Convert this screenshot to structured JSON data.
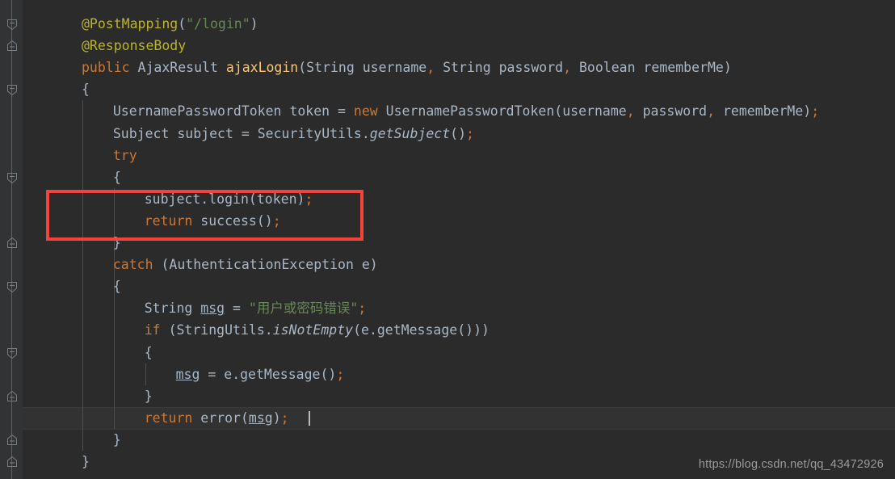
{
  "editor": {
    "background_color": "#2B2B2B",
    "gutter_color": "#313335",
    "current_line_color": "#323232",
    "caret_color": "#BBBBBB",
    "default_text_color": "#A9B7C6",
    "keyword_color": "#CC7832",
    "annotation_color": "#BBB529",
    "string_color": "#6A8759",
    "method_color": "#FFC66D",
    "highlight_box_color": "#F4433A"
  },
  "code": {
    "language": "Java",
    "lines": [
      {
        "n": 1,
        "indent": 0,
        "text": "@PostMapping(\"/login\")"
      },
      {
        "n": 2,
        "indent": 0,
        "text": "@ResponseBody"
      },
      {
        "n": 3,
        "indent": 0,
        "text": "public AjaxResult ajaxLogin(String username, String password, Boolean rememberMe)"
      },
      {
        "n": 4,
        "indent": 0,
        "text": "{"
      },
      {
        "n": 5,
        "indent": 1,
        "text": "UsernamePasswordToken token = new UsernamePasswordToken(username, password, rememberMe);"
      },
      {
        "n": 6,
        "indent": 1,
        "text": "Subject subject = SecurityUtils.getSubject();"
      },
      {
        "n": 7,
        "indent": 1,
        "text": "try"
      },
      {
        "n": 8,
        "indent": 1,
        "text": "{"
      },
      {
        "n": 9,
        "indent": 2,
        "text": "subject.login(token);"
      },
      {
        "n": 10,
        "indent": 2,
        "text": "return success();"
      },
      {
        "n": 11,
        "indent": 1,
        "text": "}"
      },
      {
        "n": 12,
        "indent": 1,
        "text": "catch (AuthenticationException e)"
      },
      {
        "n": 13,
        "indent": 1,
        "text": "{"
      },
      {
        "n": 14,
        "indent": 2,
        "text": "String msg = \"用户或密码错误\";"
      },
      {
        "n": 15,
        "indent": 2,
        "text": "if (StringUtils.isNotEmpty(e.getMessage()))"
      },
      {
        "n": 16,
        "indent": 2,
        "text": "{"
      },
      {
        "n": 17,
        "indent": 3,
        "text": "msg = e.getMessage();"
      },
      {
        "n": 18,
        "indent": 2,
        "text": "}"
      },
      {
        "n": 19,
        "indent": 2,
        "text": "return error(msg);"
      },
      {
        "n": 20,
        "indent": 1,
        "text": "}"
      },
      {
        "n": 21,
        "indent": 0,
        "text": "}"
      }
    ],
    "string_literals": [
      "/login",
      "用户或密码错误"
    ],
    "identifiers": [
      "PostMapping",
      "ResponseBody",
      "AjaxResult",
      "ajaxLogin",
      "String",
      "username",
      "password",
      "Boolean",
      "rememberMe",
      "UsernamePasswordToken",
      "token",
      "Subject",
      "subject",
      "SecurityUtils",
      "getSubject",
      "login",
      "success",
      "AuthenticationException",
      "e",
      "msg",
      "StringUtils",
      "isNotEmpty",
      "getMessage",
      "error"
    ],
    "keywords": [
      "public",
      "new",
      "try",
      "catch",
      "return",
      "if"
    ],
    "current_line": 19
  },
  "gutter": {
    "markers": [
      {
        "kind": "fold-collapse-region-start",
        "line": 1
      },
      {
        "kind": "fold-collapse-single",
        "line": 2
      },
      {
        "kind": "fold-collapse-region-start",
        "line": 4
      },
      {
        "kind": "fold-collapse-region-start",
        "line": 8
      },
      {
        "kind": "fold-collapse-single",
        "line": 11
      },
      {
        "kind": "fold-collapse-region-start",
        "line": 13
      },
      {
        "kind": "fold-collapse-region-start",
        "line": 16
      },
      {
        "kind": "fold-collapse-single",
        "line": 18
      },
      {
        "kind": "fold-collapse-single",
        "line": 20
      },
      {
        "kind": "fold-collapse-single",
        "line": 21
      }
    ]
  },
  "annotation": {
    "box_label": "highlighted-code-region",
    "covers_lines": [
      9,
      10
    ]
  },
  "watermark": {
    "text": "https://blog.csdn.net/qq_43472926"
  }
}
